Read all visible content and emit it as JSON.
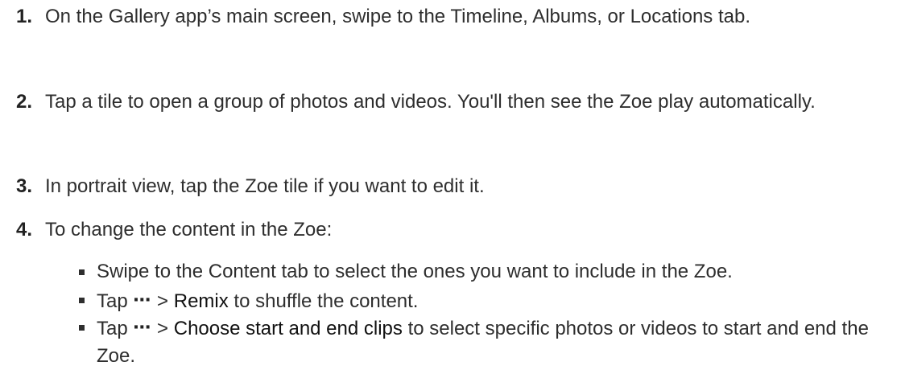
{
  "steps": [
    {
      "number": "1.",
      "text": "On the Gallery app’s main screen, swipe to the Timeline, Albums, or Locations tab."
    },
    {
      "number": "2.",
      "text": "Tap a tile to open a group of photos and videos. You'll then see the Zoe play automatically."
    },
    {
      "number": "3.",
      "text": "In portrait view, tap the Zoe tile if you want to edit it."
    },
    {
      "number": "4.",
      "text": "To change the content in the Zoe:"
    }
  ],
  "bullets": [
    {
      "text": "Swipe to the Content tab to select the ones you want to include in the Zoe."
    },
    {
      "prefix": "Tap",
      "icon": "more-dots-icon",
      "icon_glyph": "⋯",
      "separator": ">",
      "keyword": "Remix",
      "suffix": "to shuffle the content."
    },
    {
      "prefix": "Tap",
      "icon": "more-dots-icon",
      "icon_glyph": "⋯",
      "separator": ">",
      "keyword": "Choose start and end clips",
      "suffix": "to select specific photos or videos to start and end the Zoe."
    }
  ]
}
